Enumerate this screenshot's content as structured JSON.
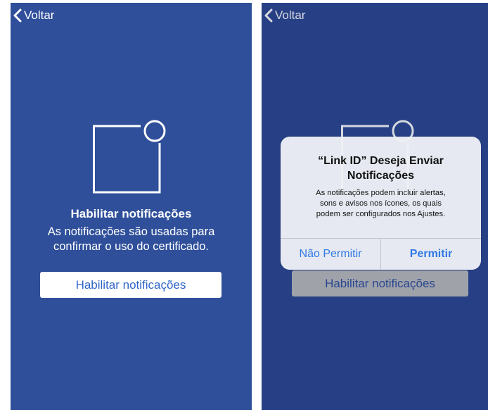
{
  "left_screen": {
    "back_label": "Voltar",
    "title": "Habilitar notificações",
    "description_line1": "As notificações são usadas para",
    "description_line2": "confirmar o uso do certificado.",
    "button_label": "Habilitar notificações"
  },
  "right_screen": {
    "back_label": "Voltar",
    "button_label": "Habilitar notificações",
    "alert": {
      "title_line1": "“Link ID” Deseja Enviar",
      "title_line2": "Notificações",
      "message_line1": "As notificações podem incluir alertas,",
      "message_line2": "sons e avisos nos ícones, os quais",
      "message_line3": "podem ser configurados nos Ajustes.",
      "deny_label": "Não Permitir",
      "allow_label": "Permitir"
    }
  },
  "colors": {
    "background_blue": "#2f4f9a",
    "button_text_blue": "#2f65c8",
    "alert_button_blue": "#2f7ae5"
  },
  "icons": [
    "chevron-left-icon",
    "notification-badge-icon"
  ]
}
